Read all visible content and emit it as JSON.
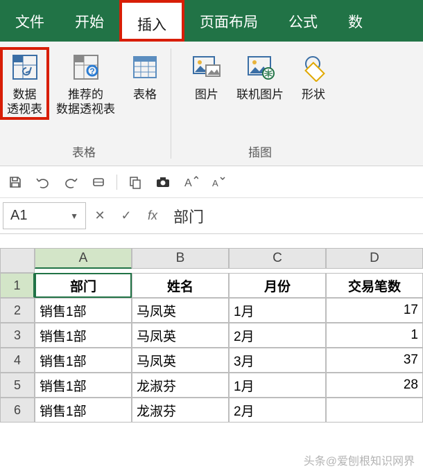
{
  "ribbon": {
    "tabs": [
      "文件",
      "开始",
      "插入",
      "页面布局",
      "公式",
      "数"
    ],
    "groups": {
      "tables": {
        "label": "表格",
        "items": [
          {
            "label": "数据\n透视表",
            "icon": "pivot-table"
          },
          {
            "label": "推荐的\n数据透视表",
            "icon": "recommended-pivot"
          },
          {
            "label": "表格",
            "icon": "table"
          }
        ]
      },
      "illustrations": {
        "label": "插图",
        "items": [
          {
            "label": "图片",
            "icon": "picture"
          },
          {
            "label": "联机图片",
            "icon": "online-picture"
          },
          {
            "label": "形状",
            "icon": "shapes"
          }
        ]
      }
    }
  },
  "qat": [
    "save",
    "undo",
    "redo",
    "touch",
    "copy",
    "camera",
    "font-increase",
    "font-decrease"
  ],
  "namebox": {
    "ref": "A1"
  },
  "formulabar": {
    "fx_label": "fx",
    "value": "部门"
  },
  "grid": {
    "columns": [
      "A",
      "B",
      "C",
      "D"
    ],
    "headers": [
      "部门",
      "姓名",
      "月份",
      "交易笔数"
    ],
    "rows": [
      {
        "n": 2,
        "cells": [
          "销售1部",
          "马凤英",
          "1月",
          "17"
        ]
      },
      {
        "n": 3,
        "cells": [
          "销售1部",
          "马凤英",
          "2月",
          "1"
        ]
      },
      {
        "n": 4,
        "cells": [
          "销售1部",
          "马凤英",
          "3月",
          "37"
        ]
      },
      {
        "n": 5,
        "cells": [
          "销售1部",
          "龙淑芬",
          "1月",
          "28"
        ]
      },
      {
        "n": 6,
        "cells": [
          "销售1部",
          "龙淑芬",
          "2月",
          ""
        ]
      }
    ],
    "active_cell": "A1"
  },
  "watermark": "头条@爱刨根知识网界"
}
